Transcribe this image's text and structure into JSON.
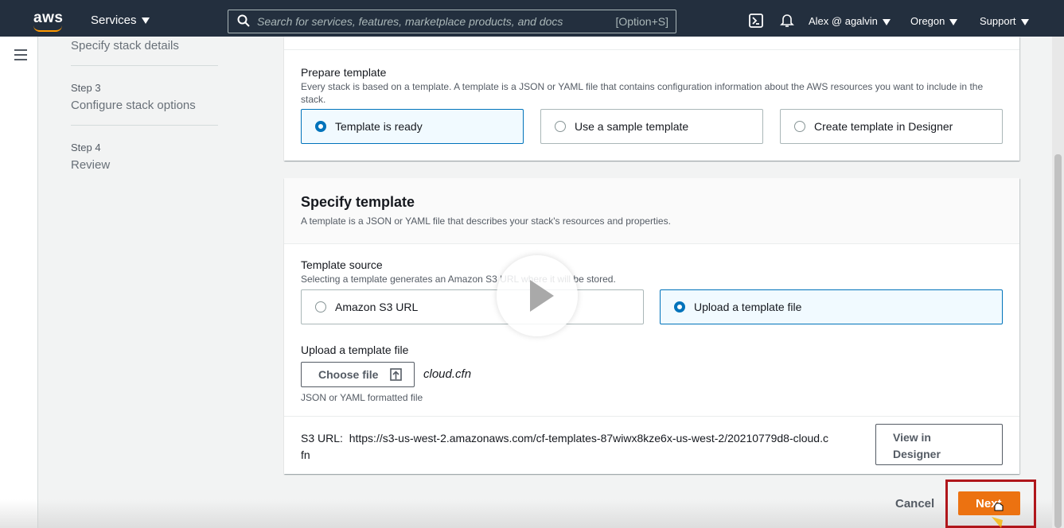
{
  "topnav": {
    "logo": "aws",
    "services": "Services",
    "search_placeholder": "Search for services, features, marketplace products, and docs",
    "search_shortcut": "[Option+S]",
    "user": "Alex @ agalvin",
    "region": "Oregon",
    "support": "Support"
  },
  "wizard": {
    "step2_title": "Specify stack details",
    "step3_label": "Step 3",
    "step3_title": "Configure stack options",
    "step4_label": "Step 4",
    "step4_title": "Review"
  },
  "prepare": {
    "title": "Prepare template",
    "description": "Every stack is based on a template. A template is a JSON or YAML file that contains configuration information about the AWS resources you want to include in the stack.",
    "options": [
      "Template is ready",
      "Use a sample template",
      "Create template in Designer"
    ],
    "selected_index": 0
  },
  "specify": {
    "title": "Specify template",
    "description": "A template is a JSON or YAML file that describes your stack's resources and properties.",
    "source_title": "Template source",
    "source_desc": "Selecting a template generates an Amazon S3 URL where it will be stored.",
    "source_options": [
      "Amazon S3 URL",
      "Upload a template file"
    ],
    "selected_index": 1,
    "upload_title": "Upload a template file",
    "choose_file": "Choose file",
    "filename": "cloud.cfn",
    "upload_hint": "JSON or YAML formatted file",
    "s3_label": "S3 URL:",
    "s3_url_line1": "https://s3-us-west-2.amazonaws.com/cf-templates-87wiwx8kze6x-us-west-2/20210779d8-cloud.c",
    "s3_url_line2": "fn",
    "view_designer_line1": "View in",
    "view_designer_line2": "Designer"
  },
  "footer": {
    "cancel": "Cancel",
    "next": "Next"
  },
  "colors": {
    "nav_bg": "#232f3e",
    "primary": "#ec7211",
    "selected_border": "#0073bb",
    "highlight_box": "#b0161b"
  }
}
